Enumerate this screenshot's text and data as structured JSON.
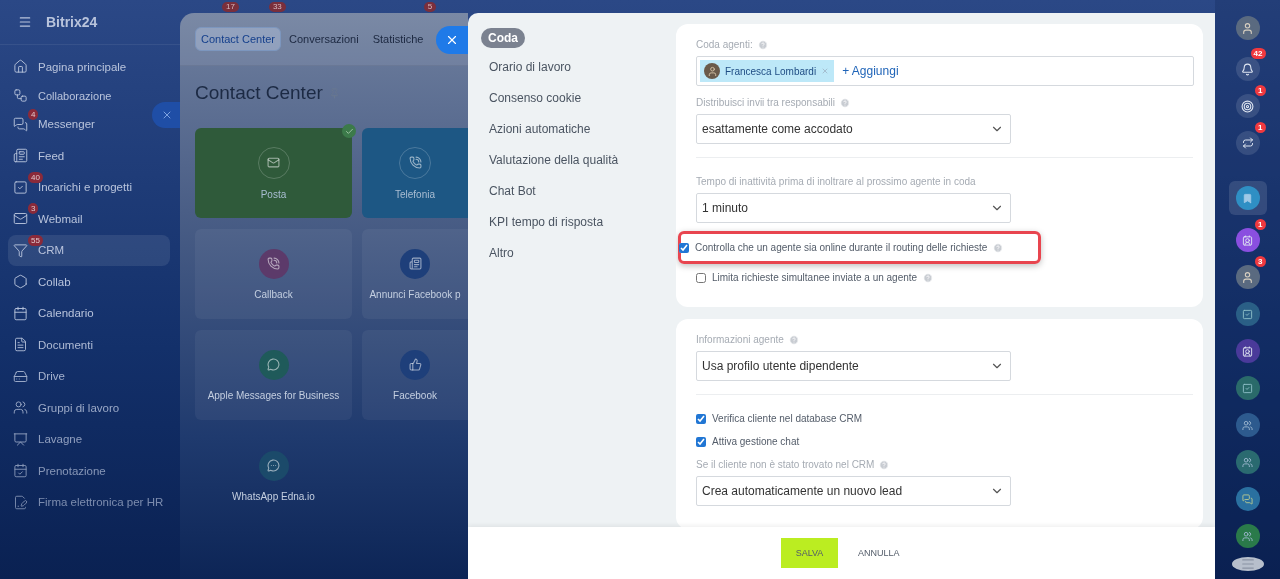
{
  "sidebar": {
    "logo": "Bitrix24",
    "items": [
      {
        "kind": "item",
        "label": "Pagina principale",
        "selected": false
      },
      {
        "kind": "group",
        "label": "Collaborazione",
        "selected": false
      },
      {
        "kind": "item",
        "label": "Messenger",
        "badge": "4",
        "selected": false
      },
      {
        "kind": "item",
        "label": "Feed",
        "selected": false
      },
      {
        "kind": "item",
        "label": "Incarichi e progetti",
        "badge": "40",
        "selected": false
      },
      {
        "kind": "item",
        "label": "Webmail",
        "badge": "3",
        "selected": false
      },
      {
        "kind": "item",
        "label": "CRM",
        "badge": "55",
        "selected": true
      },
      {
        "kind": "item",
        "label": "Collab",
        "selected": false
      },
      {
        "kind": "item",
        "label": "Calendario",
        "selected": false
      },
      {
        "kind": "item",
        "label": "Documenti",
        "selected": false
      },
      {
        "kind": "item",
        "label": "Drive",
        "selected": false
      },
      {
        "kind": "item",
        "label": "Gruppi di lavoro",
        "selected": false
      },
      {
        "kind": "item",
        "label": "Lavagne",
        "selected": false
      },
      {
        "kind": "item",
        "label": "Prenotazione",
        "selected": false
      },
      {
        "kind": "item",
        "label": "Firma elettronica per HR",
        "selected": false
      }
    ]
  },
  "top_badges": [
    "17",
    "33",
    "5"
  ],
  "contact_center": {
    "tabs": [
      {
        "label": "Contact Center",
        "selected": true
      },
      {
        "label": "Conversazioni",
        "selected": false
      },
      {
        "label": "Statistiche",
        "selected": false
      }
    ],
    "title": "Contact Center",
    "channels": [
      {
        "label": "Posta",
        "kind": "active",
        "connected": true,
        "color": "#2f5a3a"
      },
      {
        "label": "Telefonia",
        "kind": "active",
        "connected": false,
        "color": "#1d5784"
      },
      {
        "label": "Callback",
        "kind": "plain",
        "connected": false,
        "color": "#5c3a6a"
      },
      {
        "label": "Annunci Facebook p",
        "kind": "plain",
        "connected": false,
        "color": "#1e3f7a"
      },
      {
        "label": "Apple Messages for Business",
        "kind": "plain",
        "connected": false,
        "color": "#1f5a5a"
      },
      {
        "label": "Facebook",
        "kind": "plain",
        "connected": false,
        "color": "#1e3f7a"
      },
      {
        "label": "WhatsApp Edna.io",
        "kind": "bare",
        "connected": false,
        "color": "#1b4a6a"
      }
    ]
  },
  "settings": {
    "nav": [
      {
        "label": "Coda",
        "selected": true
      },
      {
        "label": "Orario di lavoro",
        "selected": false
      },
      {
        "label": "Consenso cookie",
        "selected": false
      },
      {
        "label": "Azioni automatiche",
        "selected": false
      },
      {
        "label": "Valutazione della qualità",
        "selected": false
      },
      {
        "label": "Chat Bot",
        "selected": false
      },
      {
        "label": "KPI tempo di risposta",
        "selected": false
      },
      {
        "label": "Altro",
        "selected": false
      }
    ],
    "sections": [
      {
        "fields": [
          {
            "kind": "people",
            "label": "Coda agenti:",
            "help": true,
            "people": [
              "Francesca Lombardi"
            ],
            "add": "+ Aggiungi"
          },
          {
            "kind": "select",
            "label": "Distribuisci invii tra responsabili",
            "help": true,
            "value": "esattamente come accodato"
          },
          {
            "kind": "divider"
          },
          {
            "kind": "select",
            "label": "Tempo di inattività prima di inoltrare al prossimo agente in coda",
            "help": false,
            "value": "1 minuto"
          },
          {
            "kind": "checkbox",
            "label": "Controlla che un agente sia online durante il routing delle richieste",
            "checked": true,
            "help": true,
            "highlighted": true
          },
          {
            "kind": "checkbox",
            "label": "Limita richieste simultanee inviate a un agente",
            "checked": false,
            "help": true,
            "highlighted": false
          }
        ]
      },
      {
        "fields": [
          {
            "kind": "select",
            "label": "Informazioni agente",
            "help": true,
            "value": "Usa profilo utente dipendente"
          },
          {
            "kind": "divider"
          },
          {
            "kind": "checkbox",
            "label": "Verifica cliente nel database CRM",
            "checked": true,
            "help": false,
            "highlighted": false
          },
          {
            "kind": "checkbox",
            "label": "Attiva gestione chat",
            "checked": true,
            "help": false,
            "highlighted": false
          },
          {
            "kind": "select",
            "label": "Se il cliente non è stato trovato nel CRM",
            "help": true,
            "value": "Crea automaticamente un nuovo lead"
          }
        ]
      }
    ],
    "footer": {
      "save": "SALVA",
      "cancel": "ANNULLA"
    }
  },
  "right_bar": {
    "items": [
      {
        "kind": "avatar"
      },
      {
        "kind": "bell",
        "badge": "42"
      },
      {
        "kind": "target",
        "badge": "1"
      },
      {
        "kind": "swap",
        "badge": "1"
      },
      {
        "kind": "divider"
      },
      {
        "kind": "bookmark",
        "color": "#2f8fc4"
      },
      {
        "kind": "contact",
        "color": "#8a4fe0",
        "badge": "1"
      },
      {
        "kind": "avatar",
        "badge": "3"
      },
      {
        "kind": "check",
        "color": "#2a5f86"
      },
      {
        "kind": "contact",
        "color": "#4a3a9a"
      },
      {
        "kind": "check",
        "color": "#2a6a6a"
      },
      {
        "kind": "people",
        "color": "#2d5a8e"
      },
      {
        "kind": "people",
        "color": "#2a6a70"
      },
      {
        "kind": "chat",
        "color": "#2a70a0"
      },
      {
        "kind": "people",
        "color": "#2a7a4a"
      },
      {
        "kind": "menu"
      }
    ]
  }
}
